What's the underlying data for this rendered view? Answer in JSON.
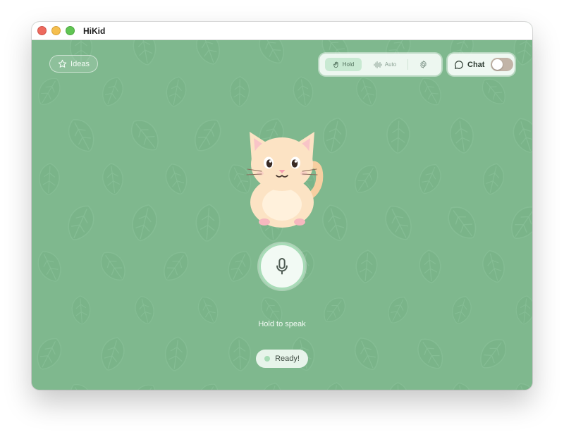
{
  "window": {
    "title": "HiKid"
  },
  "toolbar": {
    "ideas_label": "Ideas",
    "modes": [
      {
        "label": "Hold",
        "selected": true,
        "icon": "hand-icon"
      },
      {
        "label": "Auto",
        "selected": false,
        "icon": "waveform-icon"
      }
    ],
    "settings_icon": "gear-icon",
    "chat": {
      "label": "Chat",
      "icon": "chat-bubble-icon",
      "enabled": false
    }
  },
  "main": {
    "mic_icon": "microphone-icon",
    "hold_label": "Hold to speak",
    "status_text": "Ready!"
  },
  "colors": {
    "background": "#7fb88e",
    "accent_light": "#c8e9d2",
    "mic_ring": "#a9dcb8",
    "toggle_off": "#c2b4a7",
    "cat_fur": "#fce3c4"
  }
}
